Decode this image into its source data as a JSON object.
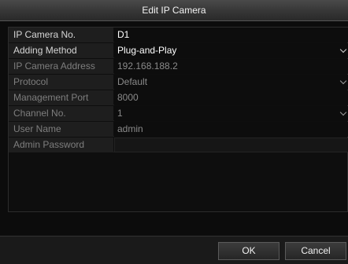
{
  "dialog": {
    "title": "Edit IP Camera",
    "fields": [
      {
        "label": "IP Camera No.",
        "value": "D1"
      },
      {
        "label": "Adding Method",
        "value": "Plug-and-Play"
      },
      {
        "label": "IP Camera Address",
        "value": "192.168.188.2"
      },
      {
        "label": "Protocol",
        "value": "Default"
      },
      {
        "label": "Management Port",
        "value": "8000"
      },
      {
        "label": "Channel No.",
        "value": "1"
      },
      {
        "label": "User Name",
        "value": "admin"
      },
      {
        "label": "Admin Password",
        "value": ""
      }
    ],
    "buttons": {
      "ok": "OK",
      "cancel": "Cancel"
    }
  }
}
